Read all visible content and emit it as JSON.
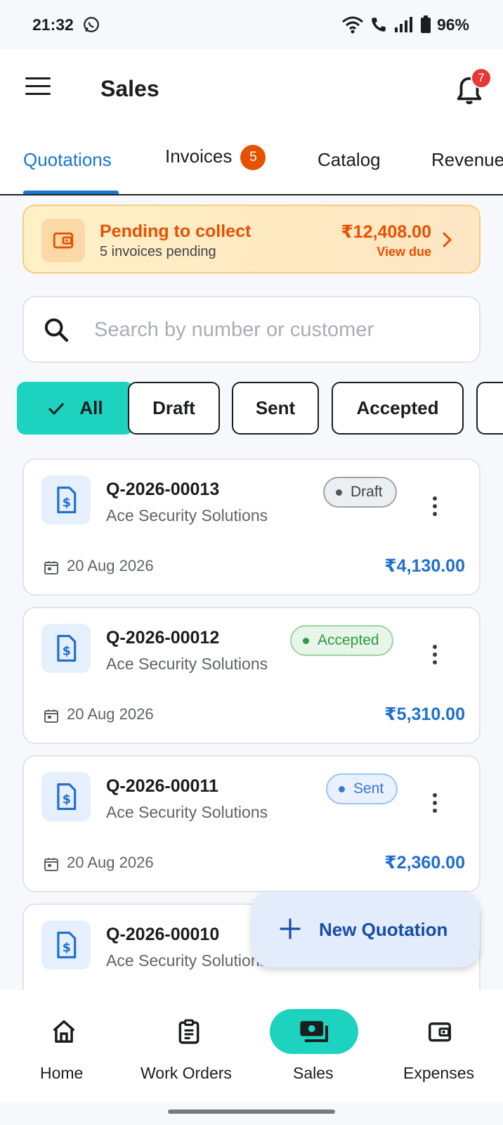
{
  "status_bar": {
    "time": "21:32",
    "battery": "96%"
  },
  "app_bar": {
    "title": "Sales",
    "notification_count": "7"
  },
  "tabs": [
    {
      "label": "Quotations",
      "active": true
    },
    {
      "label": "Invoices",
      "badge": "5"
    },
    {
      "label": "Catalog"
    },
    {
      "label": "Revenue"
    }
  ],
  "pending": {
    "title": "Pending to collect",
    "subtitle": "5 invoices pending",
    "amount": "₹12,408.00",
    "link": "View due"
  },
  "search": {
    "placeholder": "Search by number or customer"
  },
  "filters": {
    "items": [
      "All",
      "Draft",
      "Sent",
      "Accepted",
      ""
    ],
    "selected": "All"
  },
  "quotations": [
    {
      "number": "Q-2026-00013",
      "customer": "Ace Security Solutions",
      "status": "Draft",
      "date": "20 Aug 2026",
      "amount": "₹4,130.00"
    },
    {
      "number": "Q-2026-00012",
      "customer": "Ace Security Solutions",
      "status": "Accepted",
      "date": "20 Aug 2026",
      "amount": "₹5,310.00"
    },
    {
      "number": "Q-2026-00011",
      "customer": "Ace Security Solutions",
      "status": "Sent",
      "date": "20 Aug 2026",
      "amount": "₹2,360.00"
    },
    {
      "number": "Q-2026-00010",
      "customer": "Ace Security Solutions",
      "status": "",
      "date": "",
      "amount": ""
    }
  ],
  "fab": {
    "label": "New Quotation"
  },
  "bottom_nav": [
    {
      "label": "Home",
      "icon": "home-icon"
    },
    {
      "label": "Work Orders",
      "icon": "clipboard-icon"
    },
    {
      "label": "Sales",
      "icon": "cash-icon",
      "active": true
    },
    {
      "label": "Expenses",
      "icon": "wallet-icon"
    }
  ],
  "colors": {
    "accent": "#1976d2",
    "teal": "#1dd3c0",
    "warning": "#e65100",
    "amount_blue": "#1e6fd0"
  }
}
